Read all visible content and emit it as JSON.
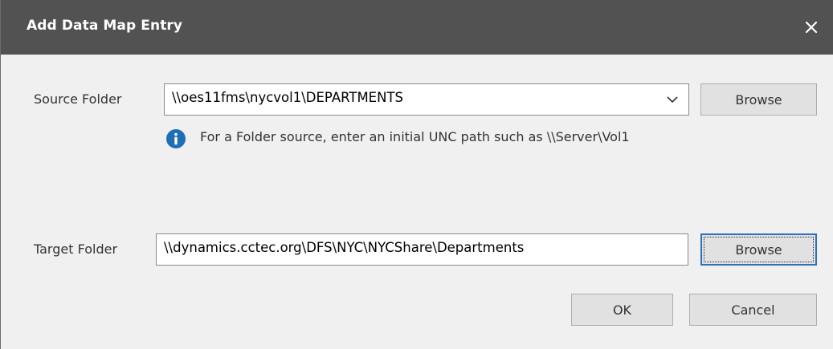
{
  "window": {
    "title": "Add Data Map Entry",
    "close_glyph": "✕"
  },
  "source": {
    "label": "Source Folder",
    "value": "\\\\oes11fms\\nycvol1\\DEPARTMENTS",
    "browse_label": "Browse",
    "info_text": "For a Folder source, enter an initial UNC path such as \\\\Server\\Vol1"
  },
  "target": {
    "label": "Target Folder",
    "value": "\\\\dynamics.cctec.org\\DFS\\NYC\\NYCShare\\Departments",
    "browse_label": "Browse"
  },
  "buttons": {
    "ok_label": "OK",
    "cancel_label": "Cancel"
  },
  "colors": {
    "titlebar": "#525252",
    "info_icon": "#1e6fb5",
    "default_button_border": "#2f6fbf"
  },
  "icons": {
    "close": "close-icon",
    "dropdown": "chevron-down-icon",
    "info": "info-icon"
  }
}
